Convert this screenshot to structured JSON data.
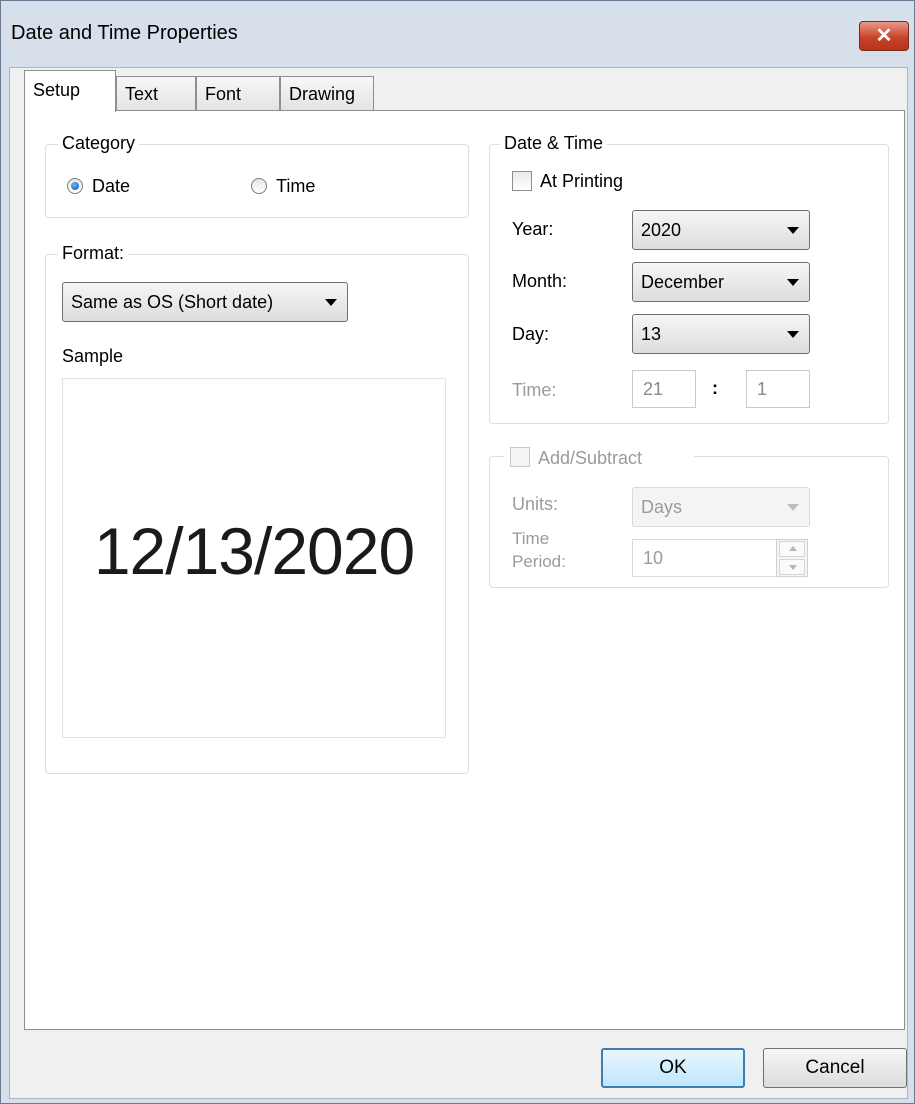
{
  "window": {
    "title": "Date and Time Properties",
    "close_glyph": "✕"
  },
  "tabs": [
    {
      "label": "Setup",
      "active": true
    },
    {
      "label": "Text",
      "active": false
    },
    {
      "label": "Font",
      "active": false
    },
    {
      "label": "Drawing",
      "active": false
    }
  ],
  "category": {
    "legend": "Category",
    "options": [
      {
        "label": "Date",
        "checked": true
      },
      {
        "label": "Time",
        "checked": false
      }
    ]
  },
  "format": {
    "legend": "Format:",
    "selected": "Same as OS (Short date)",
    "sample_label": "Sample",
    "sample_value": "12/13/2020"
  },
  "datetime": {
    "legend": "Date & Time",
    "at_printing_label": "At Printing",
    "at_printing_checked": false,
    "year_label": "Year:",
    "year_value": "2020",
    "month_label": "Month:",
    "month_value": "December",
    "day_label": "Day:",
    "day_value": "13",
    "time_label": "Time:",
    "time_hour": "21",
    "time_separator": ":",
    "time_minute": "1"
  },
  "add_subtract": {
    "legend": "Add/Subtract",
    "checked": false,
    "units_label": "Units:",
    "units_value": "Days",
    "period_label_line1": "Time",
    "period_label_line2": "Period:",
    "period_value": "10"
  },
  "buttons": {
    "ok": "OK",
    "cancel": "Cancel"
  },
  "colors": {
    "accent": "#3c7fb1",
    "close": "#c9432b",
    "frame": "#d6dfea"
  }
}
